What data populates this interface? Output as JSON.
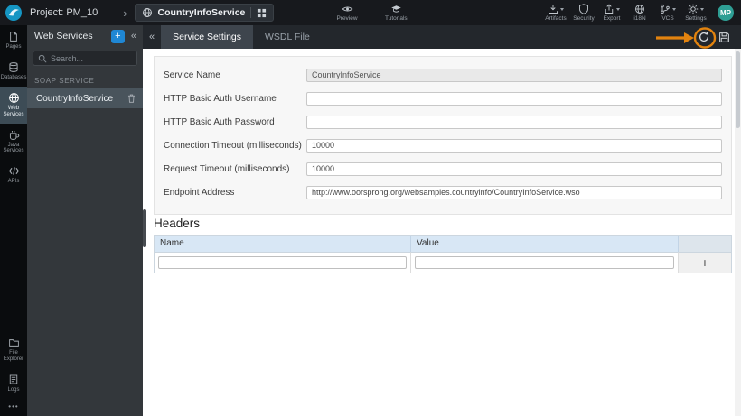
{
  "colors": {
    "accent_blue": "#1f87d4",
    "annotation_orange": "#e2830f",
    "table_header_blue": "#d8e7f5",
    "avatar_teal": "#2e9e94",
    "topbar_bg": "#17191d"
  },
  "topbar": {
    "project_label": "Project: PM_10",
    "breadcrumb_chevron": "›",
    "service_name": "CountryInfoService",
    "preview_label": "Preview",
    "tutorials_label": "Tutorials",
    "artifacts_label": "Artifacts",
    "security_label": "Security",
    "export_label": "Export",
    "i18n_label": "i18N",
    "vcs_label": "VCS",
    "settings_label": "Settings",
    "avatar_initials": "MP"
  },
  "sidebar": {
    "items": [
      {
        "label": "Pages"
      },
      {
        "label": "Databases"
      },
      {
        "label": "Web Services"
      },
      {
        "label": "Java Services"
      },
      {
        "label": "APIs"
      },
      {
        "label": "File Explorer"
      },
      {
        "label": "Logs"
      }
    ],
    "more_label": "•••"
  },
  "panel": {
    "title": "Web Services",
    "add_label": "+",
    "collapse_icon": "«",
    "search_placeholder": "Search...",
    "section_label": "SOAP SERVICE",
    "service_item": "CountryInfoService"
  },
  "tabs": {
    "collapse_icon": "«",
    "items": [
      {
        "label": "Service Settings"
      },
      {
        "label": "WSDL File"
      }
    ]
  },
  "form": {
    "fields": [
      {
        "label": "Service Name",
        "value": "CountryInfoService"
      },
      {
        "label": "HTTP Basic Auth Username",
        "value": ""
      },
      {
        "label": "HTTP Basic Auth Password",
        "value": ""
      },
      {
        "label": "Connection Timeout (milliseconds)",
        "value": "10000"
      },
      {
        "label": "Request Timeout (milliseconds)",
        "value": "10000"
      },
      {
        "label": "Endpoint Address",
        "value": "http://www.oorsprong.org/websamples.countryinfo/CountryInfoService.wso"
      }
    ]
  },
  "headers_section": {
    "title": "Headers",
    "columns": [
      "Name",
      "Value"
    ],
    "add_label": "+"
  }
}
